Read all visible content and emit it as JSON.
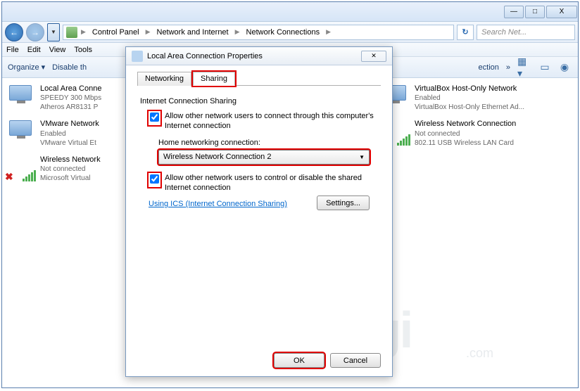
{
  "window": {
    "min": "—",
    "max": "□",
    "close": "X"
  },
  "breadcrumb": [
    "Control Panel",
    "Network and Internet",
    "Network Connections"
  ],
  "search_placeholder": "Search Net...",
  "menubar": [
    "File",
    "Edit",
    "View",
    "Tools"
  ],
  "toolbar": {
    "organize": "Organize",
    "disable": "Disable th",
    "connection": "ection",
    "chevrons": "»"
  },
  "connections": [
    {
      "title": "Local Area Conne",
      "sub1": "SPEEDY 300 Mbps",
      "sub2": "Atheros AR8131 P",
      "type": "lan"
    },
    {
      "title": "VMware Network",
      "sub1": "Enabled",
      "sub2": "VMware Virtual Et",
      "type": "lan"
    },
    {
      "title": "Wireless Network",
      "sub1": "Not connected",
      "sub2": "Microsoft Virtual",
      "type": "wifi-x"
    },
    {
      "title": "VirtualBox Host-Only Network",
      "sub1": "Enabled",
      "sub2": "VirtualBox Host-Only Ethernet Ad...",
      "type": "lan"
    },
    {
      "title": "Wireless Network Connection",
      "sub1": "Not connected",
      "sub2": "802.11 USB Wireless LAN Card",
      "type": "wifi"
    }
  ],
  "dialog": {
    "title": "Local Area Connection Properties",
    "tabs": {
      "networking": "Networking",
      "sharing": "Sharing"
    },
    "group_title": "Internet Connection Sharing",
    "chk1": "Allow other network users to connect through this computer's Internet connection",
    "home_label": "Home networking connection:",
    "dropdown_value": "Wireless Network Connection 2",
    "chk2": "Allow other network users to control or disable the shared Internet connection",
    "link": "Using ICS (Internet Connection Sharing)",
    "settings_btn": "Settings...",
    "ok": "OK",
    "cancel": "Cancel"
  },
  "watermark": "Teksnologi",
  "watermark_sub": ".com"
}
